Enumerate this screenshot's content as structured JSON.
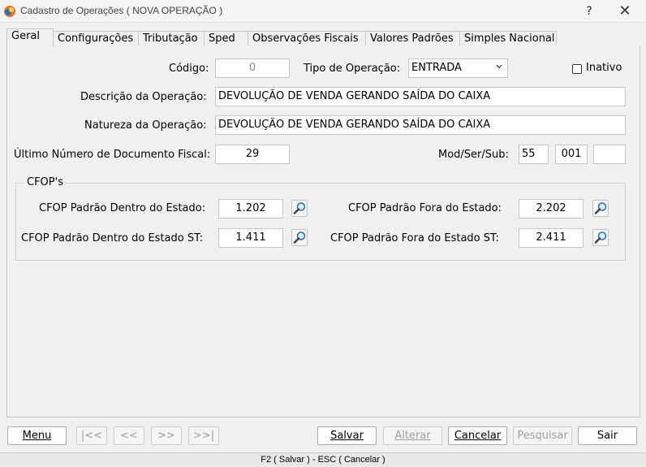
{
  "window": {
    "title": "Cadastro de Operações ( NOVA OPERAÇÃO )",
    "help_label": "?",
    "close_label": "✕"
  },
  "tabs": [
    {
      "label": "Geral"
    },
    {
      "label": "Configurações"
    },
    {
      "label": "Tributação"
    },
    {
      "label": "Sped"
    },
    {
      "label": "Observações Fiscais"
    },
    {
      "label": "Valores Padrões"
    },
    {
      "label": "Simples Nacional"
    }
  ],
  "form": {
    "codigo_label": "Código:",
    "codigo_value": "0",
    "tipo_label": "Tipo de Operação:",
    "tipo_value": "ENTRADA",
    "inativo_label": "Inativo",
    "descricao_label": "Descrição da Operação:",
    "descricao_value": "DEVOLUÇÃO DE VENDA GERANDO SAÍDA DO CAIXA",
    "natureza_label": "Natureza da Operação:",
    "natureza_value": "DEVOLUÇÃO DE VENDA GERANDO SAÍDA DO CAIXA",
    "ultimo_label": "Último Número de Documento Fiscal:",
    "ultimo_value": "29",
    "modsersub_label": "Mod/Ser/Sub:",
    "mod_value": "55",
    "ser_value": "001",
    "sub_value": ""
  },
  "cfops": {
    "group_title": "CFOP's",
    "dentro_label": "CFOP Padrão Dentro do Estado:",
    "dentro_value": "1.202",
    "fora_label": "CFOP Padrão Fora do Estado:",
    "fora_value": "2.202",
    "dentro_st_label": "CFOP Padrão Dentro do Estado ST:",
    "dentro_st_value": "1.411",
    "fora_st_label": "CFOP Padrão Fora do Estado ST:",
    "fora_st_value": "2.411"
  },
  "buttons": {
    "menu": "Menu",
    "first": "|<<",
    "prev": "<<",
    "next": ">>",
    "last": ">>|",
    "salvar": "Salvar",
    "alterar": "Alterar",
    "cancelar": "Cancelar",
    "pesquisar": "Pesquisar",
    "sair": "Sair"
  },
  "status": {
    "shortcuts": "F2 ( Salvar )  -  ESC ( Cancelar )"
  }
}
